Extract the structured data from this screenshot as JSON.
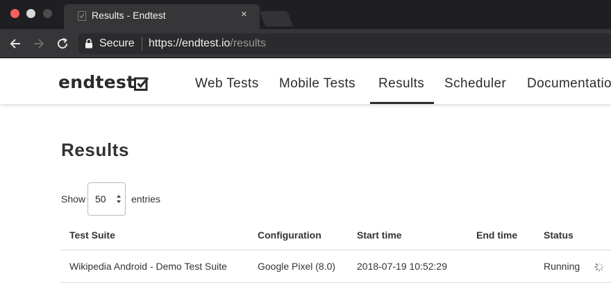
{
  "browser": {
    "tab_title": "Results - Endtest",
    "tab_close": "×",
    "secure_label": "Secure",
    "url_scheme_host": "https://endtest.io",
    "url_path": "/results",
    "colors": {
      "close": "#fc605c",
      "minimize": "#d9d9d9",
      "maximize": "#4b4b4d"
    },
    "icons": [
      "back-arrow-icon",
      "forward-arrow-icon",
      "reload-icon",
      "lock-icon"
    ]
  },
  "site": {
    "logo_text": "endtest",
    "nav": [
      {
        "label": "Web Tests"
      },
      {
        "label": "Mobile Tests"
      },
      {
        "label": "Results",
        "active": true
      },
      {
        "label": "Scheduler"
      },
      {
        "label": "Documentation"
      }
    ]
  },
  "page": {
    "title": "Results",
    "show_label": "Show",
    "entries_value": "50",
    "entries_label": "entries"
  },
  "table": {
    "columns": [
      "Test Suite",
      "Configuration",
      "Start time",
      "End time",
      "Status"
    ],
    "rows": [
      {
        "suite": "Wikipedia Android - Demo Test Suite",
        "configuration": "Google Pixel (8.0)",
        "start_time": "2018-07-19 10:52:29",
        "end_time": "",
        "status": "Running"
      }
    ]
  }
}
